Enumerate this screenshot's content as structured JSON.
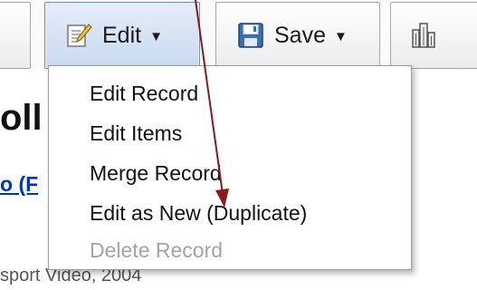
{
  "toolbar": {
    "edit_label": "Edit",
    "save_label": "Save",
    "caret": "▼"
  },
  "background": {
    "title_fragment": "oll",
    "link_fragment": "o (F",
    "subtitle_fragment": "sport Video, 2004"
  },
  "edit_menu": {
    "items": [
      {
        "label": "Edit Record",
        "enabled": true
      },
      {
        "label": "Edit Items",
        "enabled": true
      },
      {
        "label": "Merge Record",
        "enabled": true
      },
      {
        "label": "Edit as New (Duplicate)",
        "enabled": true
      },
      {
        "label": "Delete Record",
        "enabled": false
      }
    ]
  },
  "icons": {
    "edit": "edit-document-icon",
    "save": "floppy-disk-icon",
    "more": "building-icon",
    "pointer": "annotation-arrow"
  },
  "colors": {
    "edit_active_bg": "#c8d9ef",
    "link": "#0033cc",
    "disabled_text": "#a3a3a3",
    "annotation_arrow": "#8b1a1a"
  }
}
